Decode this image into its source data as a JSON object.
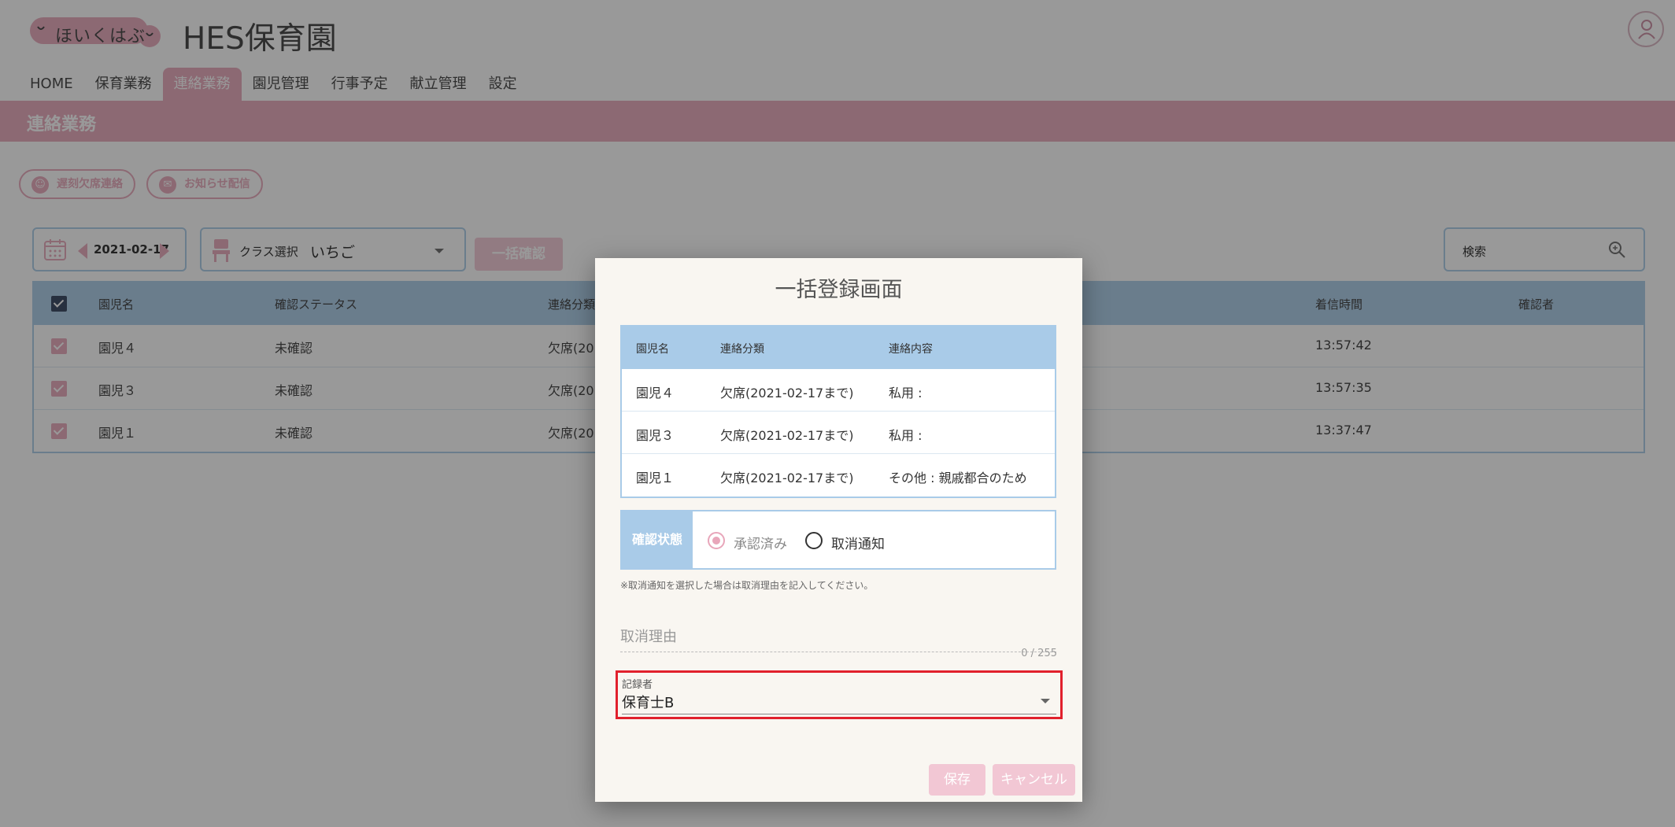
{
  "header": {
    "logo_text": "ほいくはぶ",
    "site_title": "HES保育園"
  },
  "nav": [
    {
      "label": "HOME"
    },
    {
      "label": "保育業務"
    },
    {
      "label": "連絡業務"
    },
    {
      "label": "園児管理"
    },
    {
      "label": "行事予定"
    },
    {
      "label": "献立管理"
    },
    {
      "label": "設定"
    }
  ],
  "section": {
    "title": "連絡業務"
  },
  "actions": {
    "absence_button": "遅刻欠席連絡",
    "notice_button": "お知らせ配信",
    "bulk_confirm": "一括確認"
  },
  "filters": {
    "date": "2021-02-17",
    "class_label": "クラス選択",
    "class_value": "いちご",
    "search_placeholder": "検索"
  },
  "table": {
    "headers": {
      "name": "園児名",
      "status": "確認ステータス",
      "category": "連絡分類",
      "received": "着信時間",
      "confirmer": "確認者"
    },
    "rows": [
      {
        "name": "園児４",
        "status": "未確認",
        "category": "欠席(20",
        "received": "13:57:42"
      },
      {
        "name": "園児３",
        "status": "未確認",
        "category": "欠席(20",
        "received": "13:57:35"
      },
      {
        "name": "園児１",
        "status": "未確認",
        "category": "欠席(20",
        "received": "13:37:47"
      }
    ]
  },
  "modal": {
    "title": "一括登録画面",
    "table": {
      "headers": {
        "name": "園児名",
        "category": "連絡分類",
        "content": "連絡内容"
      },
      "rows": [
        {
          "name": "園児４",
          "category": "欠席(2021-02-17まで)",
          "content": "私用 :"
        },
        {
          "name": "園児３",
          "category": "欠席(2021-02-17まで)",
          "content": "私用 :"
        },
        {
          "name": "園児１",
          "category": "欠席(2021-02-17まで)",
          "content": "その他 : 親戚都合のため"
        }
      ]
    },
    "status_label": "確認状態",
    "radio_approved": "承認済み",
    "radio_cancel": "取消通知",
    "note": "※取消通知を選択した場合は取消理由を記入してください。",
    "reason_placeholder": "取消理由",
    "counter": "0 / 255",
    "recorder_label": "記録者",
    "recorder_value": "保育士B",
    "save_label": "保存",
    "cancel_label": "キャンセル"
  },
  "colors": {
    "accent_pink": "#e8a6ba",
    "header_blue": "#a9cbe8",
    "highlight_red": "#e1202c"
  }
}
